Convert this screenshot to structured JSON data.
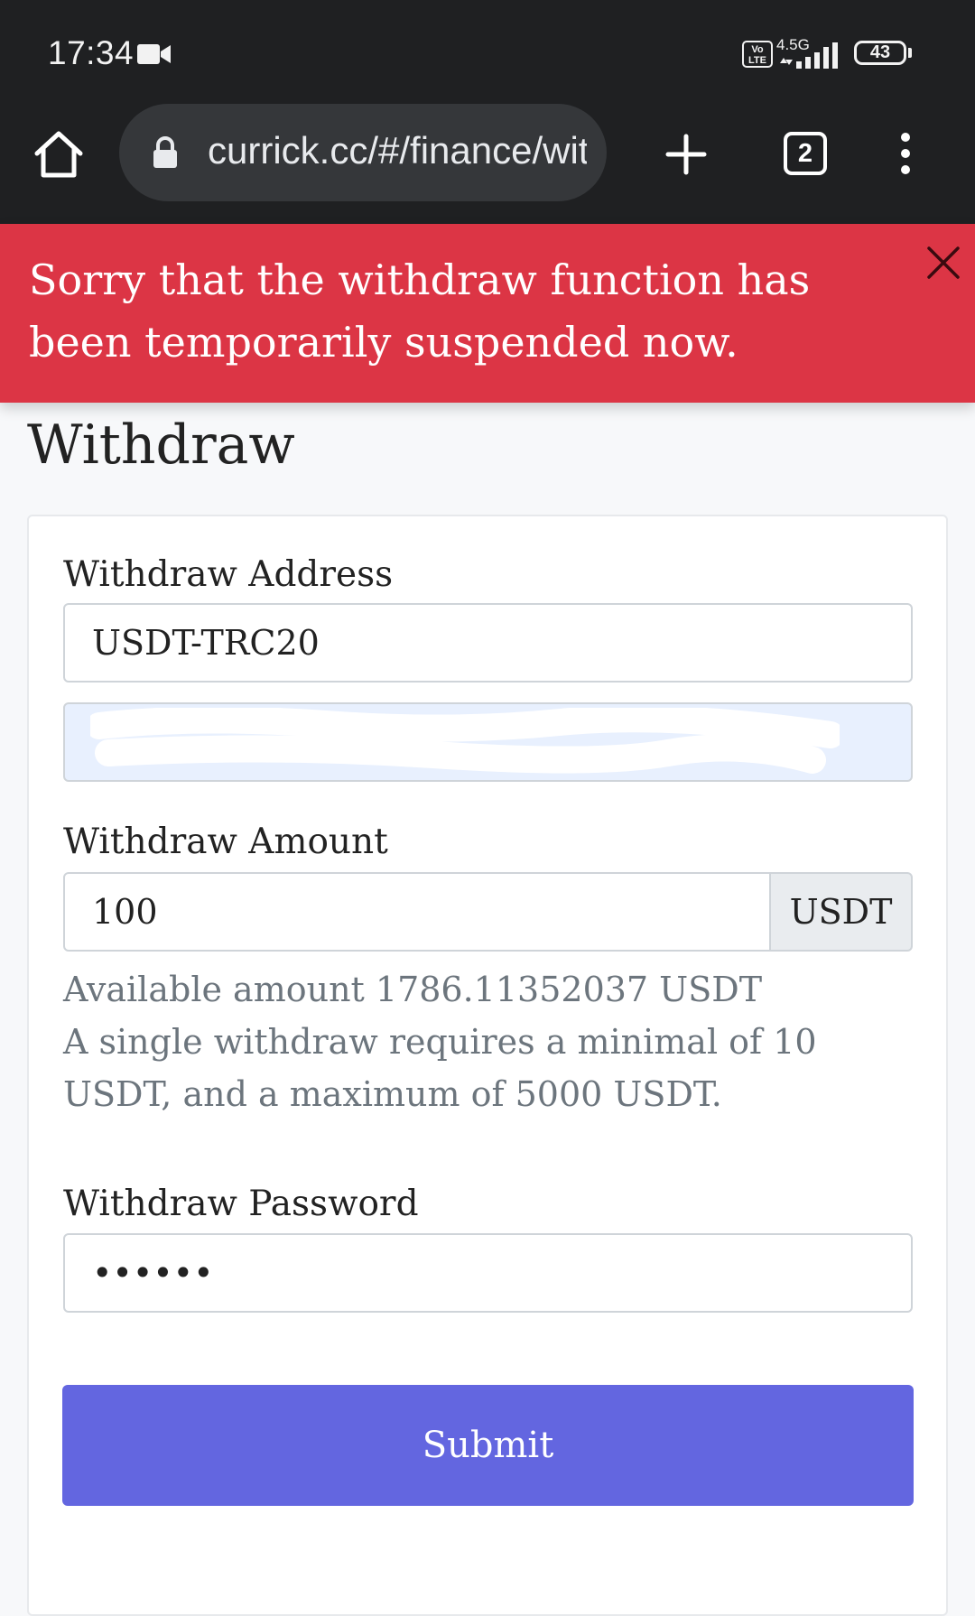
{
  "status_bar": {
    "time": "17:34",
    "network": "4.5G",
    "volte": "Vo LTE",
    "battery": "43"
  },
  "browser": {
    "url": "currick.cc/#/finance/withdraw",
    "tab_count": "2"
  },
  "alert": {
    "message": "Sorry that the withdraw function has been temporarily suspended now."
  },
  "page": {
    "title": "Withdraw"
  },
  "form": {
    "address_label": "Withdraw Address",
    "address_type": "USDT-TRC20",
    "amount_label": "Withdraw Amount",
    "amount_value": "100",
    "amount_unit": "USDT",
    "available_text": "Available amount 1786.11352037 USDT",
    "limit_text": "A single withdraw requires a minimal of 10 USDT, and a maximum of 5000 USDT.",
    "password_label": "Withdraw Password",
    "password_value": "••••••",
    "submit_label": "Submit"
  },
  "colors": {
    "alert_bg": "#dc3545",
    "primary": "#6366e0",
    "chrome_bg": "#1f2022"
  }
}
